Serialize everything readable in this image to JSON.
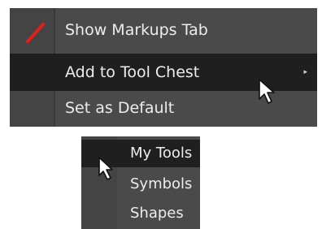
{
  "context_menu": {
    "items": [
      {
        "label": "Show Markups Tab",
        "icon": "red-pen-icon"
      },
      {
        "label": "Add to Tool Chest",
        "has_submenu": true,
        "highlighted": true
      },
      {
        "label": "Set as Default"
      }
    ],
    "submenu_arrow": "▸"
  },
  "submenu": {
    "items": [
      {
        "label": "My Tools",
        "highlighted": true
      },
      {
        "label": "Symbols"
      },
      {
        "label": "Shapes"
      }
    ]
  },
  "colors": {
    "menu_bg": "#4a4a4a",
    "highlight_bg": "#1f1f1f",
    "text": "#ececec",
    "pen_icon": "#e0201a"
  }
}
